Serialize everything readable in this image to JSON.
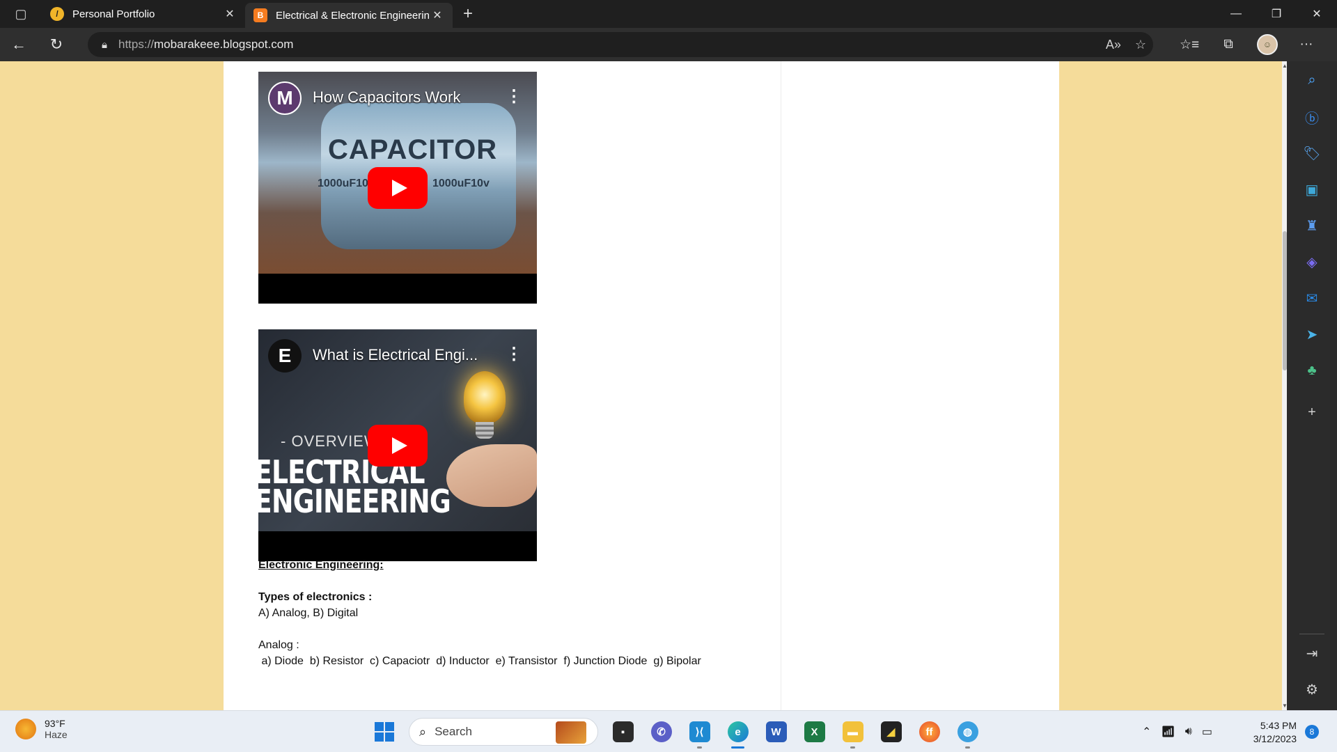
{
  "browser": {
    "tabs": [
      {
        "title": "Personal Portfolio",
        "favicon": "portfolio-icon"
      },
      {
        "title": "Electrical & Electronic Engineering",
        "favicon": "blogger-icon"
      }
    ],
    "url_scheme": "https://",
    "url_host": "mobarakeee.blogspot.com"
  },
  "videos": [
    {
      "title": "How Capacitors Work",
      "logo": "M",
      "thumb_text": "CAPACITOR",
      "thumb_sub_left": "1000uF10v",
      "thumb_sub_right": "1000uF10v"
    },
    {
      "title": "What is Electrical Engi...",
      "logo": "E",
      "thumb_overline": "- OVERVIEW -",
      "thumb_line1": "ELECTRICAL",
      "thumb_line2": "ENGINEERING"
    }
  ],
  "article": {
    "heading": "Electronic Engineering:",
    "types_label": "Types of electronics :",
    "types_value": "A) Analog, B) Digital",
    "analog_label": "Analog :",
    "analog_list": " a) Diode  b) Resistor  c) Capaciotr  d) Inductor  e) Transistor  f) Junction Diode  g) Bipolar"
  },
  "taskbar": {
    "weather_temp": "93°F",
    "weather_desc": "Haze",
    "search_label": "Search",
    "time": "5:43 PM",
    "date": "3/12/2023",
    "notification_count": "8"
  },
  "colors": {
    "page_bg": "#f5dc9a",
    "youtube_red": "#ff0000",
    "accent": "#1a78d8"
  }
}
